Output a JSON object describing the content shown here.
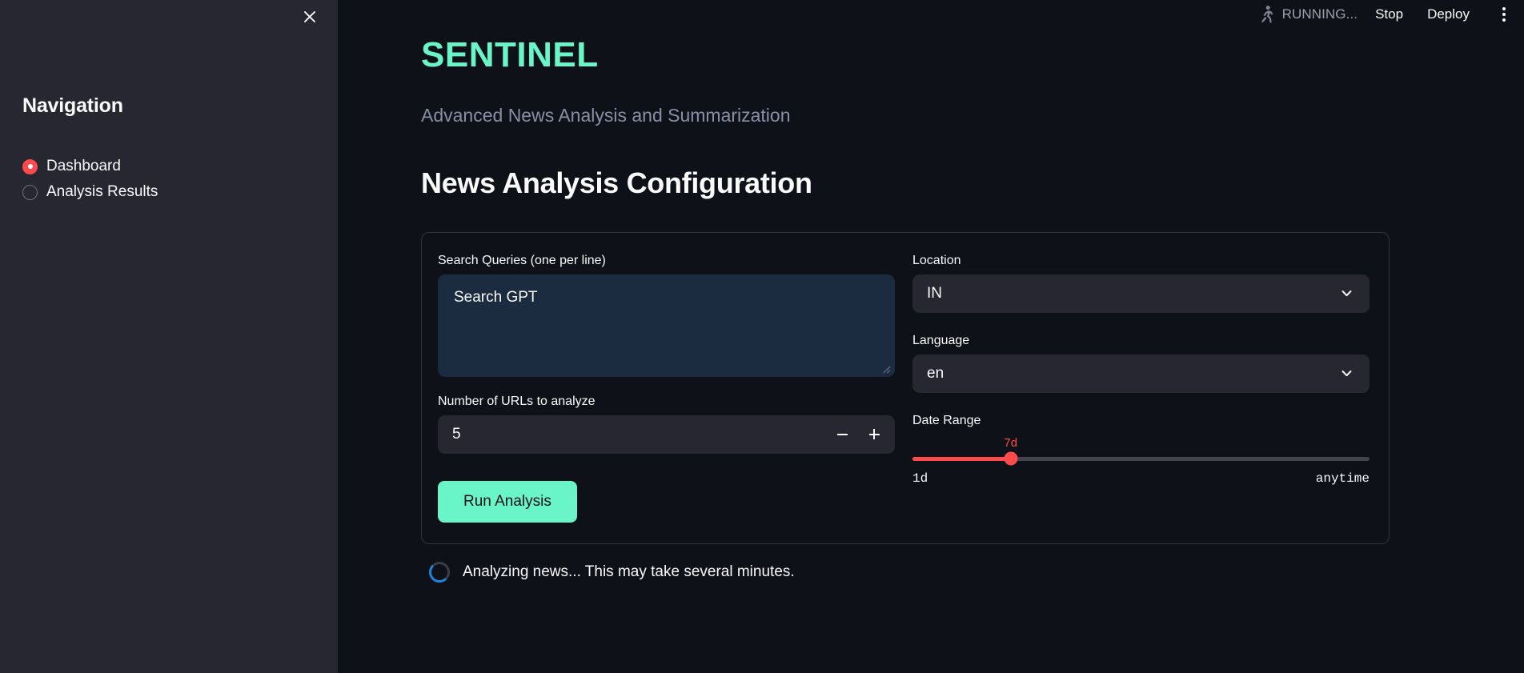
{
  "topbar": {
    "run_icon": "running-person-icon",
    "status": "RUNNING...",
    "stop_label": "Stop",
    "deploy_label": "Deploy",
    "menu_icon": "kebab-menu-icon"
  },
  "sidebar": {
    "close_icon": "close-icon",
    "heading": "Navigation",
    "items": [
      {
        "label": "Dashboard",
        "selected": true
      },
      {
        "label": "Analysis Results",
        "selected": false
      }
    ]
  },
  "main": {
    "brand_title": "SENTINEL",
    "brand_subtitle": "Advanced News Analysis and Summarization",
    "section_title": "News Analysis Configuration"
  },
  "form": {
    "search_queries": {
      "label": "Search Queries (one per line)",
      "value": "Search GPT",
      "placeholder": ""
    },
    "num_urls": {
      "label": "Number of URLs to analyze",
      "value": "5",
      "decrement_icon": "minus-icon",
      "increment_icon": "plus-icon"
    },
    "run_button": "Run Analysis",
    "location": {
      "label": "Location",
      "value": "IN",
      "chevron_icon": "chevron-down-icon"
    },
    "language": {
      "label": "Language",
      "value": "en",
      "chevron_icon": "chevron-down-icon"
    },
    "date_range": {
      "label": "Date Range",
      "value": "7d",
      "min_label": "1d",
      "max_label": "anytime",
      "fill_percent": 21.5
    }
  },
  "status": {
    "spinner_icon": "loading-spinner-icon",
    "message": "Analyzing news... This may take several minutes."
  },
  "colors": {
    "accent_mint": "#6af5c9",
    "accent_red": "#ff4b4b",
    "spinner_blue": "#1c83e1",
    "sidebar_bg": "#262730",
    "main_bg": "#0e1117",
    "input_bg": "#262730",
    "textarea_focus_bg": "#1b2b40"
  }
}
